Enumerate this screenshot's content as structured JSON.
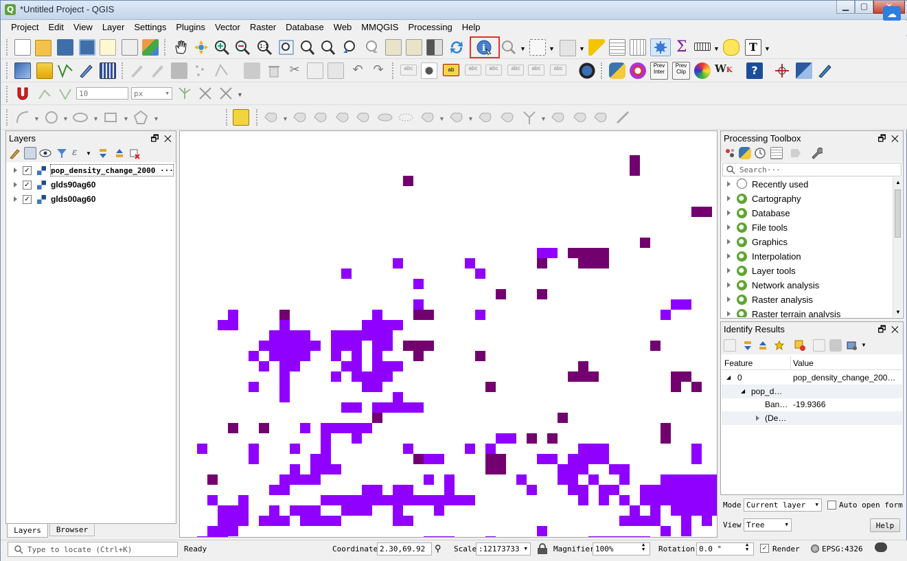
{
  "window": {
    "title": "*Untitled Project - QGIS"
  },
  "menu": [
    "Project",
    "Edit",
    "View",
    "Layer",
    "Settings",
    "Plugins",
    "Vector",
    "Raster",
    "Database",
    "Web",
    "MMQGIS",
    "Processing",
    "Help"
  ],
  "toolbar": {
    "snapping_tolerance": "10",
    "snapping_unit": "px",
    "prev_inter_label": "Prev Inter",
    "prev_clip_label": "Prev Clip"
  },
  "layers_panel": {
    "title": "Layers",
    "layers": [
      {
        "name": "pop_density_change_2000 ···",
        "checked": true,
        "selected": true
      },
      {
        "name": "glds90ag60",
        "checked": true,
        "selected": false
      },
      {
        "name": "glds00ag60",
        "checked": true,
        "selected": false
      }
    ],
    "tabs": [
      "Layers",
      "Browser"
    ]
  },
  "processing_toolbox": {
    "title": "Processing Toolbox",
    "search_placeholder": "Search···",
    "items": [
      "Recently used",
      "Cartography",
      "Database",
      "File tools",
      "Graphics",
      "Interpolation",
      "Layer tools",
      "Network analysis",
      "Raster analysis",
      "Raster terrain analysis"
    ]
  },
  "identify_results": {
    "title": "Identify Results",
    "columns": [
      "Feature",
      "Value"
    ],
    "rows": [
      {
        "feature": "0",
        "value": "pop_density_change_200…"
      },
      {
        "feature": "pop_d…",
        "value": ""
      },
      {
        "feature": "Ban…",
        "value": "-19.9366"
      },
      {
        "feature": "(De…",
        "value": ""
      }
    ],
    "mode_label": "Mode",
    "mode_value": "Current layer",
    "auto_open_label": "Auto open form",
    "view_label": "View",
    "view_value": "Tree",
    "help_label": "Help"
  },
  "statusbar": {
    "locate_placeholder": "Type to locate (Ctrl+K)",
    "status": "Ready",
    "coordinate_label": "Coordinate",
    "coordinate_value": "2.30,69.92",
    "scale_label": "Scale",
    "scale_value": ":12173733",
    "magnifier_label": "Magnifier",
    "magnifier_value": "100%",
    "rotation_label": "Rotation",
    "rotation_value": "0.0 °",
    "render_label": "Render",
    "crs": "EPSG:4326"
  },
  "colors": {
    "raster_light": "#8f00ff",
    "raster_dark": "#73006f",
    "highlight_box": "#e2302b",
    "qgis_green": "#5ea531"
  }
}
